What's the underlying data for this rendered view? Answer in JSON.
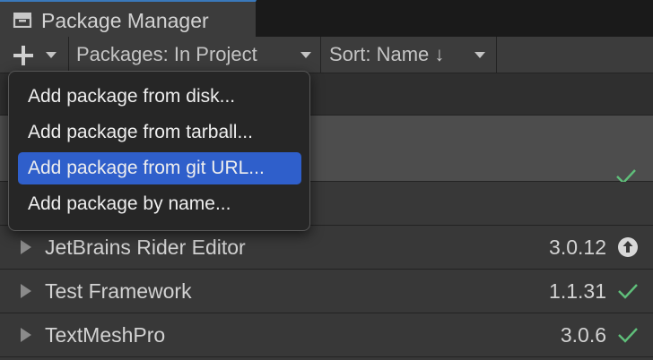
{
  "window": {
    "tab_title": "Package Manager"
  },
  "toolbar": {
    "add_symbol": "+",
    "packages_filter": "Packages: In Project",
    "sort": "Sort: Name ↓"
  },
  "menu": {
    "items": [
      {
        "label": "Add package from disk..."
      },
      {
        "label": "Add package from tarball..."
      },
      {
        "label": "Add package from git URL..."
      },
      {
        "label": "Add package by name..."
      }
    ],
    "highlighted_index": 2
  },
  "packages": [
    {
      "name": "JetBrains Rider Editor",
      "version": "3.0.12",
      "status_icon": "update-available-icon"
    },
    {
      "name": "Test Framework",
      "version": "1.1.31",
      "status_icon": "checkmark-icon"
    },
    {
      "name": "TextMeshPro",
      "version": "3.0.6",
      "status_icon": "checkmark-icon"
    }
  ],
  "colors": {
    "accent_blue": "#2f5fcb",
    "check_green": "#5fbf7a",
    "tab_accent": "#3a79bb"
  }
}
